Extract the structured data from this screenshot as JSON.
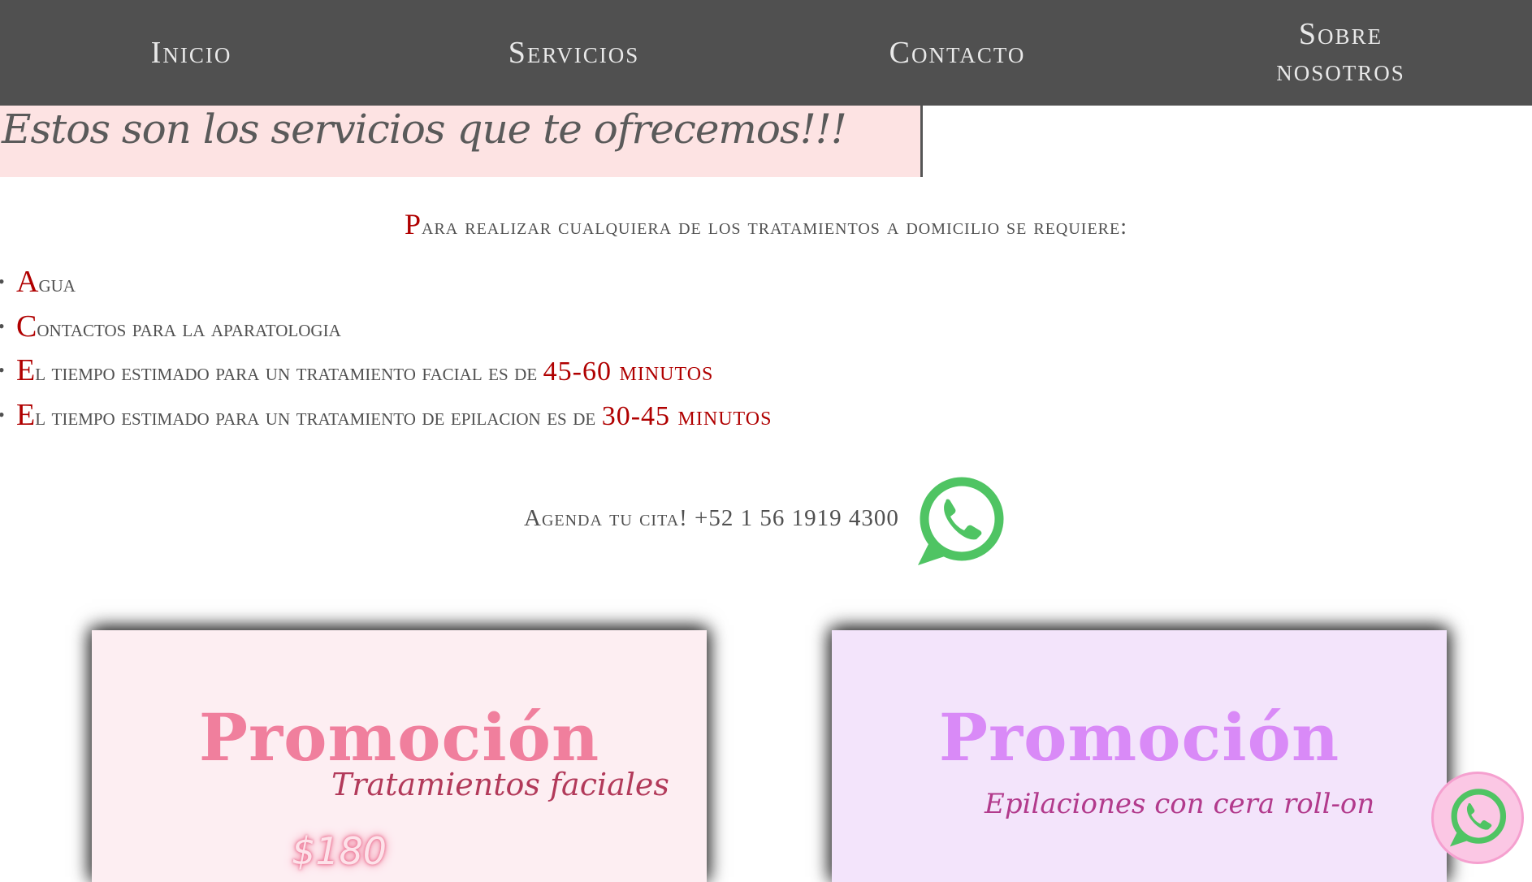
{
  "nav": {
    "items": [
      {
        "label": "Inicio"
      },
      {
        "label": "Servicios"
      },
      {
        "label": "Contacto"
      },
      {
        "label_line1": "Sobre",
        "label_line2": "nosotros"
      }
    ]
  },
  "hero": {
    "title": "Estos son los servicios que te ofrecemos!!!"
  },
  "requirements": {
    "heading_first": "P",
    "heading_rest": "ara realizar cualquiera de los tratamientos a domicilio se requiere:",
    "items": [
      {
        "first": "A",
        "rest": "gua",
        "highlight": ""
      },
      {
        "first": "C",
        "rest": "ontactos para la aparatologia",
        "highlight": ""
      },
      {
        "first": "E",
        "rest": "l tiempo estimado para un tratamiento facial es de ",
        "highlight": "45-60 minutos"
      },
      {
        "first": "E",
        "rest": "l tiempo estimado para un tratamiento de epilacion es de ",
        "highlight": "30-45 minutos"
      }
    ]
  },
  "agenda": {
    "text": "Agenda tu cita! +52 1 56 1919 4300",
    "icon": "whatsapp-icon"
  },
  "promos": [
    {
      "title": "Promoción",
      "subtitle": "Tratamientos faciales",
      "price": "$180",
      "accent": "#f07f9d"
    },
    {
      "title": "Promoción",
      "subtitle": "Epilaciones con cera roll-on",
      "accent": "#d98af7"
    }
  ],
  "colors": {
    "nav_bg": "#505050",
    "hero_bg": "#fde3e3",
    "accent_red": "#b00000",
    "whatsapp_green": "#4fc463",
    "float_button_bg": "#fbc7e4"
  }
}
